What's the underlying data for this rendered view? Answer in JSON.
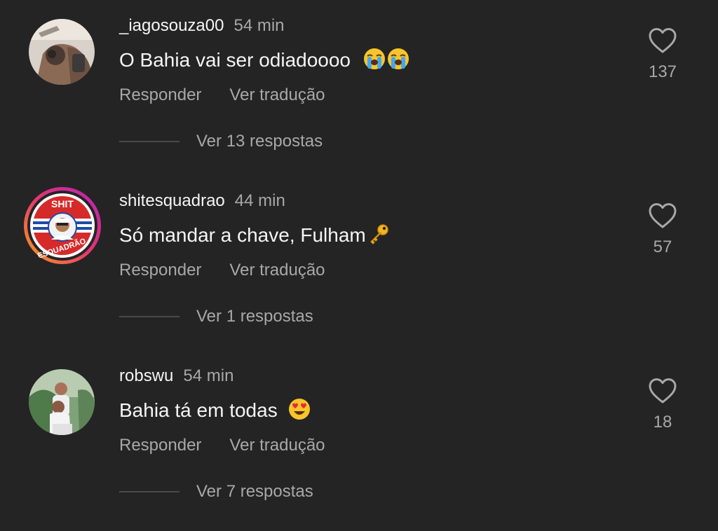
{
  "comments": [
    {
      "username": "_iagosouza00",
      "time": "54 min",
      "text": "O Bahia vai ser odiadoooo",
      "emoji": [
        "loudly-crying-face-icon",
        "loudly-crying-face-icon"
      ],
      "reply_label": "Responder",
      "translate_label": "Ver tradução",
      "view_replies": "Ver 13 respostas",
      "likes": "137"
    },
    {
      "username": "shitesquadrao",
      "time": "44 min",
      "text": "Só mandar a chave, Fulham",
      "emoji": [
        "key-icon"
      ],
      "reply_label": "Responder",
      "translate_label": "Ver tradução",
      "view_replies": "Ver 1 respostas",
      "likes": "57",
      "avatar_logo_text": [
        "SHIT",
        "ESQUADRÃO"
      ]
    },
    {
      "username": "robswu",
      "time": "54 min",
      "text": "Bahia tá em todas",
      "emoji": [
        "smiling-face-with-heart-eyes-icon"
      ],
      "reply_label": "Responder",
      "translate_label": "Ver tradução",
      "view_replies": "Ver 7 respostas",
      "likes": "18"
    }
  ],
  "colors": {
    "background": "#242424",
    "primary_text": "#f5f5f5",
    "secondary_text": "#a8a8a8",
    "story_ring": [
      "#f9a21b",
      "#e6356f",
      "#b622b7"
    ]
  }
}
